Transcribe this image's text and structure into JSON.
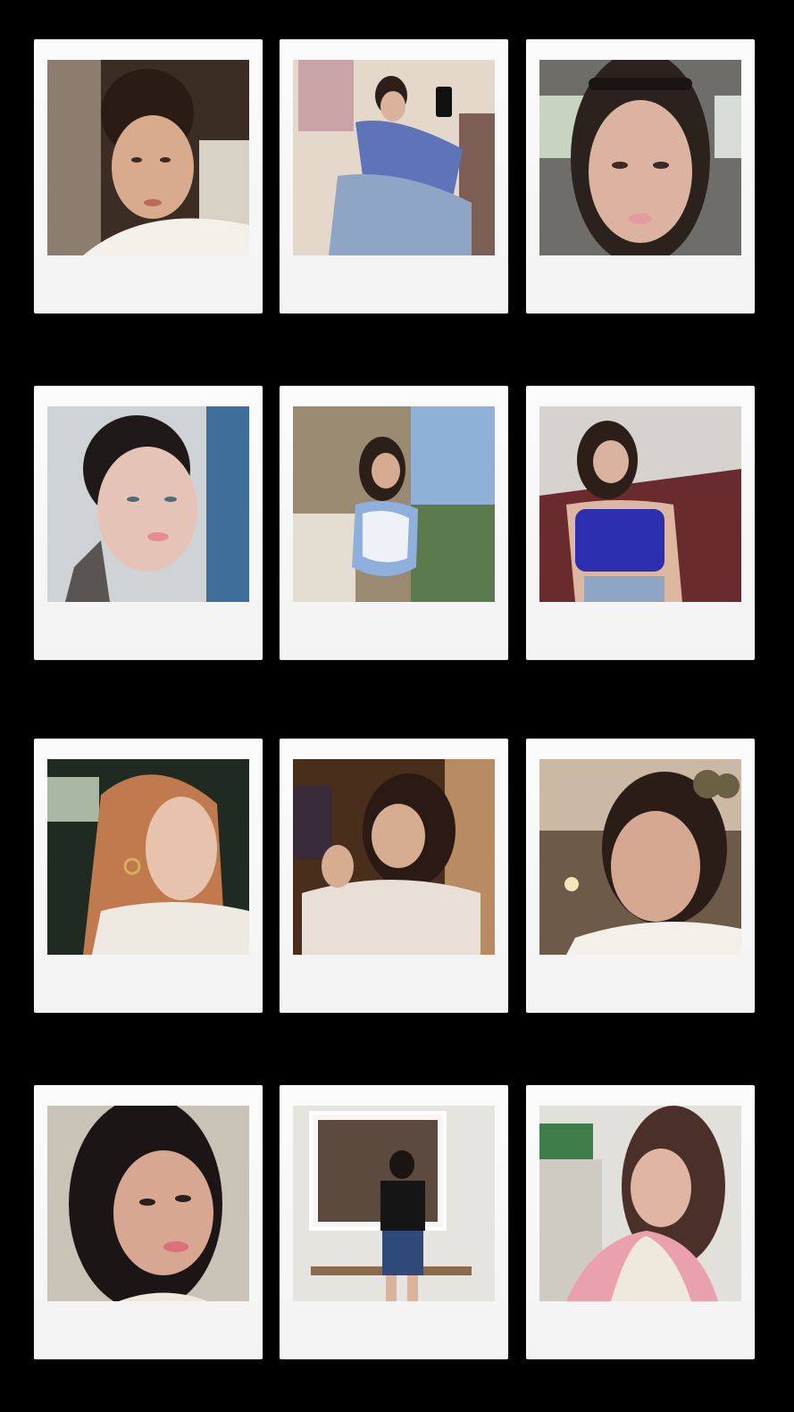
{
  "collage": {
    "background_color": "#000000",
    "frame_color": "#f6f6f6",
    "photos": [
      {
        "subject": "woman-selfie-bun-white-tee",
        "tones": [
          "#3a2a22",
          "#c9a58a",
          "#f2efe9"
        ]
      },
      {
        "subject": "woman-blue-sweater-jeans-mirror-selfie",
        "tones": [
          "#e3d6c8",
          "#5b6fb5",
          "#8aa0c4"
        ]
      },
      {
        "subject": "woman-car-selfie-headband",
        "tones": [
          "#6f6f6b",
          "#d7b09c",
          "#2d221d"
        ]
      },
      {
        "subject": "woman-slick-back-hair-blue-wall",
        "tones": [
          "#3e6f9a",
          "#e2c1b4",
          "#1f1a19"
        ]
      },
      {
        "subject": "woman-floral-dress-by-window",
        "tones": [
          "#9b8a72",
          "#8fb1d8",
          "#5b7a4d"
        ]
      },
      {
        "subject": "woman-blue-crop-top-chair",
        "tones": [
          "#6a2b2e",
          "#2b2fb0",
          "#d9d4cf"
        ]
      },
      {
        "subject": "redhead-profile-car-interior",
        "tones": [
          "#1e2a22",
          "#c07a4d",
          "#eeeae2"
        ]
      },
      {
        "subject": "woman-phone-mirror-selfie-cream-sweater",
        "tones": [
          "#4a2e1c",
          "#e8e0d6",
          "#b98b63"
        ]
      },
      {
        "subject": "woman-sunglasses-on-head-cafe",
        "tones": [
          "#6d5a48",
          "#d2a48c",
          "#f3efe9"
        ]
      },
      {
        "subject": "woman-dark-hair-pearl-necklace",
        "tones": [
          "#c9c3b7",
          "#d6a590",
          "#1b1615"
        ]
      },
      {
        "subject": "woman-black-top-denim-skirt-storefront",
        "tones": [
          "#e6e4df",
          "#151515",
          "#2f4a7a"
        ]
      },
      {
        "subject": "woman-pink-cardigan-white-room",
        "tones": [
          "#e2e0db",
          "#e9a2ad",
          "#4a3028"
        ]
      }
    ]
  }
}
